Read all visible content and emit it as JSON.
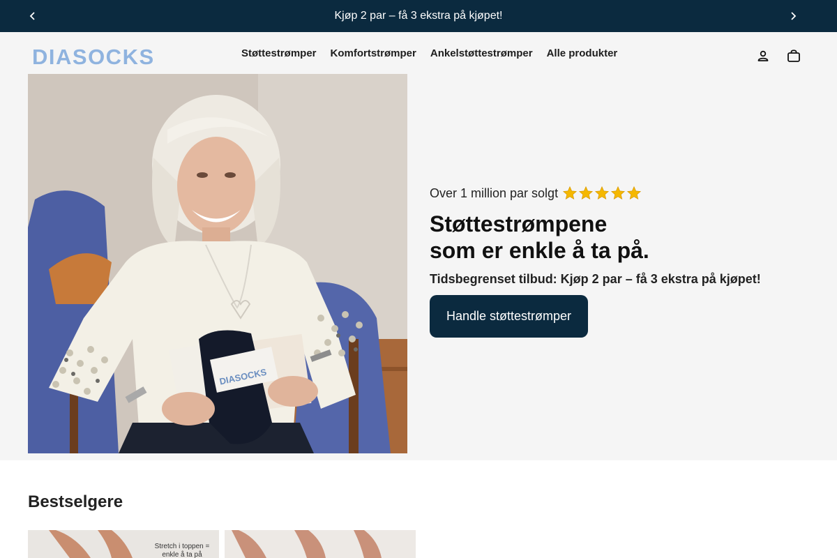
{
  "announcement": {
    "text": "Kjøp 2 par – få 3 ekstra på kjøpet!",
    "prev_icon": "chevron-left-icon",
    "next_icon": "chevron-right-icon"
  },
  "header": {
    "logo": "DIASOCKS",
    "nav": [
      {
        "label": "Støttestrømper"
      },
      {
        "label": "Komfortstrømper"
      },
      {
        "label": "Ankelstøttestrømper"
      },
      {
        "label": "Alle produkter"
      }
    ],
    "account_icon": "account-icon",
    "cart_icon": "shopping-bag-icon"
  },
  "hero": {
    "rating_text": "Over 1 million par solgt",
    "rating_stars": 5,
    "heading_line1": "Støttestrømpene",
    "heading_line2": "som er enkle å ta på.",
    "offer": "Tidsbegrenset tilbud: Kjøp 2 par – få 3 ekstra på kjøpet!",
    "button_label": "Handle støttestrømper",
    "image_label": "DIASOCKS"
  },
  "bestsellers": {
    "title": "Bestselgere",
    "card1_caption_line1": "Stretch i toppen =",
    "card1_caption_line2": "enkle å ta på"
  },
  "colors": {
    "brand_dark": "#0b2a3f",
    "logo_blue": "#8fb3df",
    "star": "#f5b800"
  }
}
